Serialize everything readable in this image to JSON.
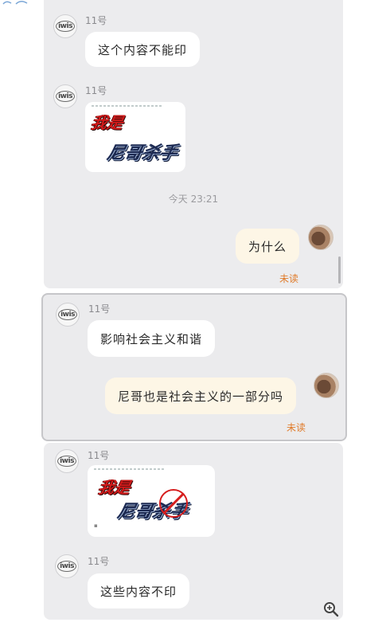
{
  "screenshot_1": {
    "messages": [
      {
        "sender": "11号",
        "avatar_text": "iwis",
        "text": "这个内容不能印"
      },
      {
        "sender": "11号",
        "avatar_text": "iwis",
        "image": {
          "red_text": "我是",
          "blue_text": "尼哥杀手"
        }
      }
    ],
    "time_divider": "今天  23:21",
    "my_message": {
      "text": "为什么",
      "status": "未读"
    }
  },
  "screenshot_2": {
    "messages": [
      {
        "sender": "11号",
        "avatar_text": "iwis",
        "text": "影响社会主义和谐"
      }
    ],
    "my_message": {
      "text": "尼哥也是社会主义的一部分吗",
      "status": "未读"
    }
  },
  "screenshot_3": {
    "messages": [
      {
        "sender": "11号",
        "avatar_text": "iwis",
        "image": {
          "red_text": "我是",
          "blue_text": "尼哥杀手",
          "prohibited": true
        }
      },
      {
        "sender": "11号",
        "avatar_text": "iwis",
        "text": "这些内容不印"
      }
    ]
  },
  "icons": {
    "zoom": "zoom-in-icon",
    "corner": "link-icon"
  },
  "colors": {
    "chat_bg": "#ececee",
    "my_bubble": "#fdf6e6",
    "unread": "#e07b2a",
    "prohibit_red": "#d61e1e"
  }
}
